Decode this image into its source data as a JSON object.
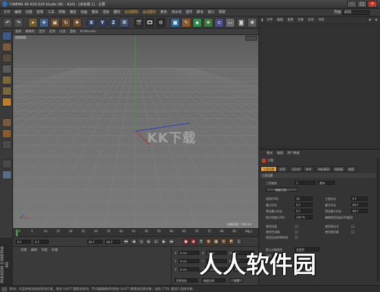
{
  "window": {
    "title": "CINEMA 4D R20.026 Studio (RC - R20) - [未标题 1] - 主要",
    "min": "–",
    "max": "□",
    "close": "✕"
  },
  "menu": {
    "items": [
      "文件",
      "编辑",
      "创建",
      "选择",
      "工具",
      "网格",
      "捕捉",
      "动画",
      "模拟",
      "渲染",
      "雕刻",
      "运动跟踪",
      "运动图形",
      "角色",
      "流水线",
      "插件",
      "脚本",
      "窗口",
      "帮助"
    ],
    "interface_label": "界面:",
    "interface_value": "启动"
  },
  "toolbar": {
    "axis_x": "X",
    "axis_y": "Y",
    "axis_z": "Z"
  },
  "viewport": {
    "tabs": [
      "查看",
      "摄像机",
      "显示",
      "选项",
      "过滤",
      "面板",
      "ProRender"
    ],
    "label": "透视视图",
    "grid_spacing": "网格间距 : 100 cm",
    "watermark": "KK下载"
  },
  "timeline": {
    "ticks": [
      "0",
      "5",
      "10",
      "15",
      "20",
      "25",
      "30",
      "35",
      "40",
      "45",
      "50",
      "55",
      "60",
      "65",
      "70",
      "75",
      "80",
      "85",
      "90"
    ],
    "end": "0 F"
  },
  "transport": {
    "start_frame": "0 F",
    "current_frame": "0 F",
    "end_frame": "90 F",
    "end_frame2": "90 F"
  },
  "materials": {
    "tabs": [
      "创建",
      "编辑",
      "功能",
      "纹理"
    ]
  },
  "coords": {
    "rows": [
      {
        "axis": "X",
        "pos": "0 cm",
        "axis2": "X",
        "size": "0 cm",
        "axis3": "H",
        "rot": "0 °"
      },
      {
        "axis": "Y",
        "pos": "0 cm",
        "axis2": "Y",
        "size": "0 cm",
        "axis3": "P",
        "rot": "0 °"
      },
      {
        "axis": "Z",
        "pos": "0 cm",
        "axis2": "Z",
        "size": "0 cm",
        "axis3": "B",
        "rot": "0 °"
      }
    ],
    "mode": "世界坐标",
    "size_mode": "缩放比例",
    "apply": "应用"
  },
  "objects": {
    "tabs": [
      "文件",
      "编辑",
      "查看",
      "对象",
      "标签",
      "书签"
    ]
  },
  "attributes": {
    "tabs": [
      "模式",
      "编辑",
      "用户数据"
    ],
    "section_icon_label": "工程",
    "subtabs": [
      "工程设置",
      "信息",
      "动力学",
      "参考",
      "待办事项",
      "帧插值",
      "插值"
    ],
    "section_title": "工程设置",
    "scale_label": "工程缩放",
    "scale_value": "1",
    "scale_unit": "厘米",
    "scale_button": "缩放工程...",
    "fields": [
      {
        "label": "帧率(FPS)",
        "value": "30",
        "label2": "工程时长",
        "value2": "0 F"
      },
      {
        "label": "最小时长",
        "value": "0 F",
        "label2": "最大时长",
        "value2": "90 F"
      },
      {
        "label": "预览最小时长",
        "value": "0 F",
        "label2": "预览最大时长",
        "value2": "90 F"
      },
      {
        "label": "细节程度(LOD)",
        "value": "100 %",
        "label2": "编辑使用渲染LOD级别",
        "value2": ""
      }
    ],
    "checks": [
      {
        "label": "使用动画",
        "label2": "使用表达式"
      },
      {
        "label": "使用生成器",
        "label2": "使用变形器"
      },
      {
        "label": "使用运动剪辑系统",
        "label2": ""
      }
    ],
    "default_color_label": "默认对象颜色",
    "default_color_value": "灰蓝色",
    "color_label": "颜色"
  },
  "status": "移动：点击并拖动鼠标移动元素。按住 SHIFT 键量化移动；节点编辑模式时按住 SHIFT 键增加选择对象；按住 CTRL 键减少选择对象。",
  "overlay": "人人软件园",
  "side_logo": "MAXON CINEMA 4D"
}
